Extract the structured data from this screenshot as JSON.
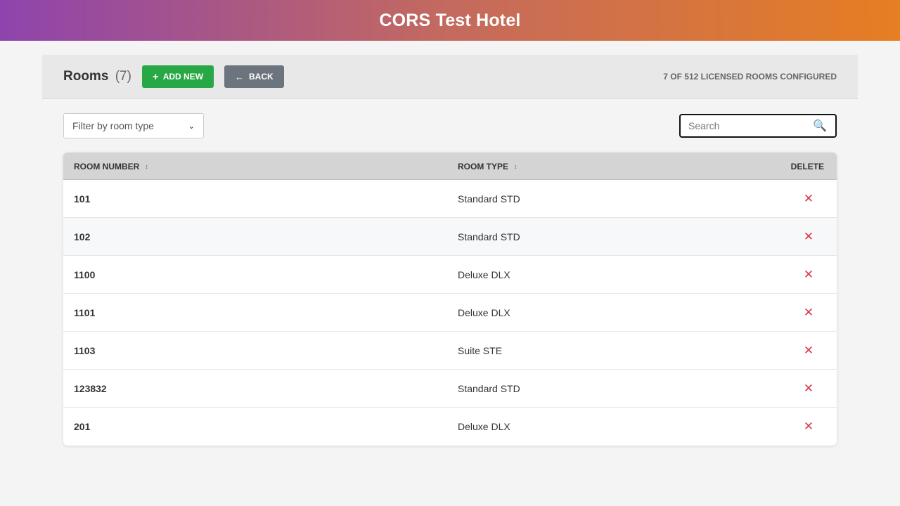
{
  "header": {
    "title": "CORS Test Hotel",
    "gradient_start": "#8e44ad",
    "gradient_end": "#e67e22"
  },
  "toolbar": {
    "heading": "Rooms",
    "count": "(7)",
    "add_label": "ADD NEW",
    "add_icon": "plus-icon",
    "back_label": "BACK",
    "back_icon": "arrow-left-icon",
    "license_text": "7 OF 512 LICENSED ROOMS CONFIGURED"
  },
  "filter": {
    "selected": "Filter by room type"
  },
  "search": {
    "placeholder": "Search",
    "value": ""
  },
  "table": {
    "columns": [
      "ROOM NUMBER",
      "ROOM TYPE",
      "DELETE"
    ],
    "rows": [
      {
        "number": "101",
        "type": "Standard STD"
      },
      {
        "number": "102",
        "type": "Standard STD"
      },
      {
        "number": "1100",
        "type": "Deluxe DLX"
      },
      {
        "number": "1101",
        "type": "Deluxe DLX"
      },
      {
        "number": "1103",
        "type": "Suite STE"
      },
      {
        "number": "123832",
        "type": "Standard STD"
      },
      {
        "number": "201",
        "type": "Deluxe DLX"
      }
    ]
  },
  "colors": {
    "add": "#28a745",
    "back": "#6c757d",
    "delete": "#dc3545"
  }
}
